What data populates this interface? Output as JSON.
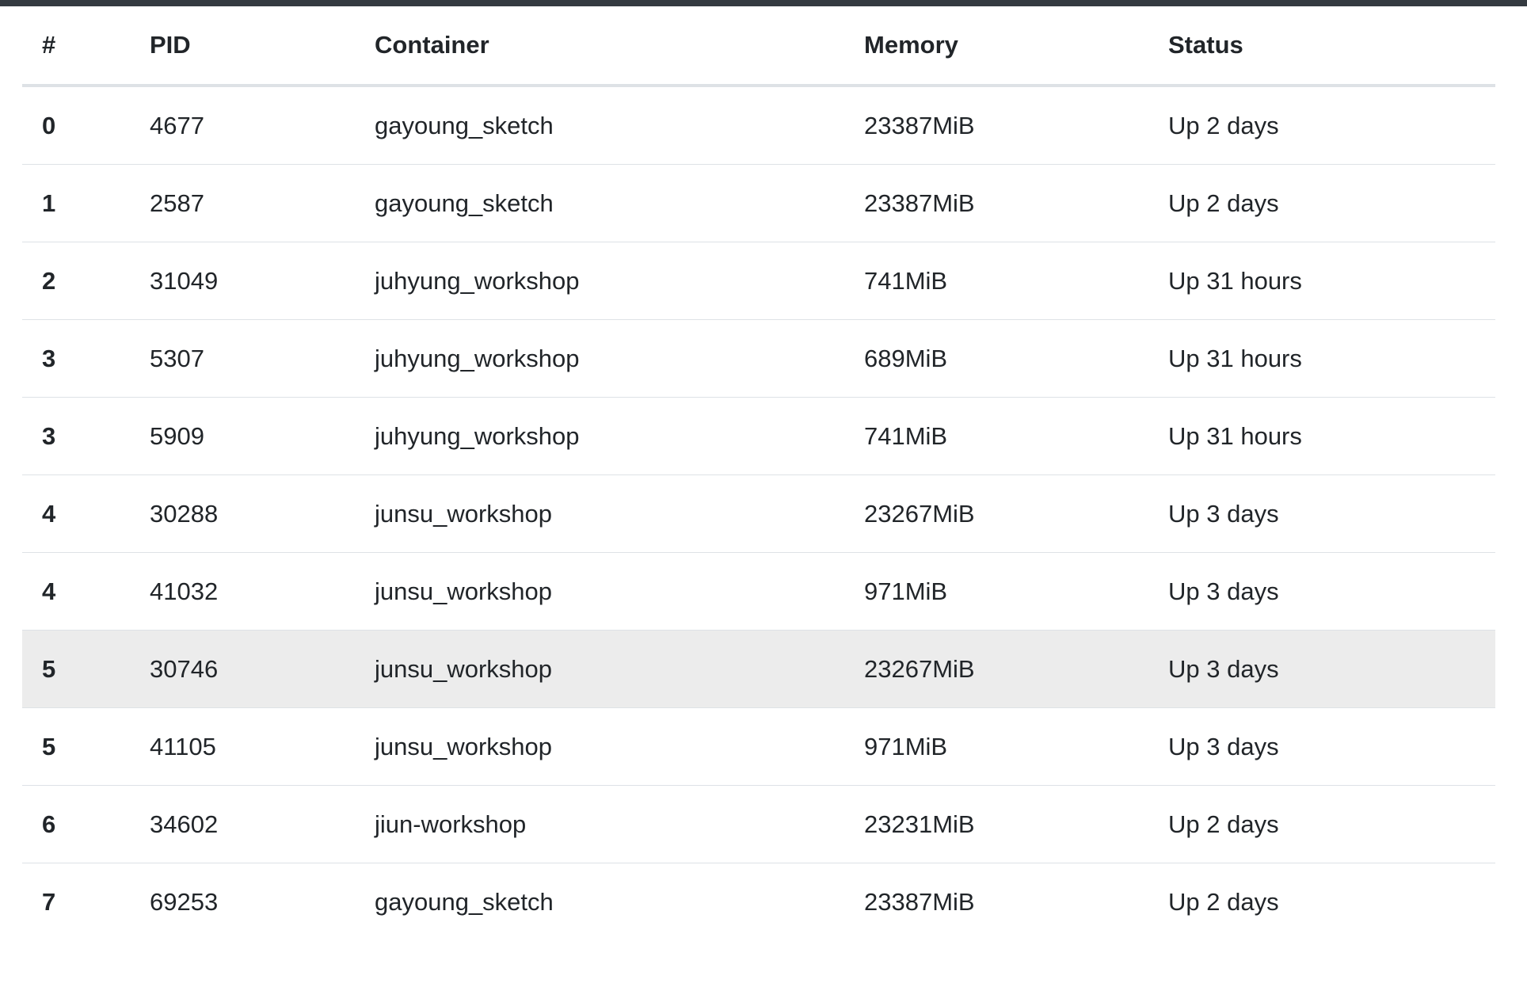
{
  "table": {
    "headers": [
      "#",
      "PID",
      "Container",
      "Memory",
      "Status"
    ],
    "rows": [
      {
        "gpu": "0",
        "pid": "4677",
        "container": "gayoung_sketch",
        "memory": "23387MiB",
        "status": "Up 2 days"
      },
      {
        "gpu": "1",
        "pid": "2587",
        "container": "gayoung_sketch",
        "memory": "23387MiB",
        "status": "Up 2 days"
      },
      {
        "gpu": "2",
        "pid": "31049",
        "container": "juhyung_workshop",
        "memory": "741MiB",
        "status": "Up 31 hours"
      },
      {
        "gpu": "3",
        "pid": "5307",
        "container": "juhyung_workshop",
        "memory": "689MiB",
        "status": "Up 31 hours"
      },
      {
        "gpu": "3",
        "pid": "5909",
        "container": "juhyung_workshop",
        "memory": "741MiB",
        "status": "Up 31 hours"
      },
      {
        "gpu": "4",
        "pid": "30288",
        "container": "junsu_workshop",
        "memory": "23267MiB",
        "status": "Up 3 days"
      },
      {
        "gpu": "4",
        "pid": "41032",
        "container": "junsu_workshop",
        "memory": "971MiB",
        "status": "Up 3 days"
      },
      {
        "gpu": "5",
        "pid": "30746",
        "container": "junsu_workshop",
        "memory": "23267MiB",
        "status": "Up 3 days"
      },
      {
        "gpu": "5",
        "pid": "41105",
        "container": "junsu_workshop",
        "memory": "971MiB",
        "status": "Up 3 days"
      },
      {
        "gpu": "6",
        "pid": "34602",
        "container": "jiun-workshop",
        "memory": "23231MiB",
        "status": "Up 2 days"
      },
      {
        "gpu": "7",
        "pid": "69253",
        "container": "gayoung_sketch",
        "memory": "23387MiB",
        "status": "Up 2 days"
      }
    ],
    "highlighted_row": 7
  },
  "colors": {
    "top_bar": "#343a40",
    "row_highlight": "#ececec",
    "border": "#dee2e6",
    "text": "#212529"
  }
}
